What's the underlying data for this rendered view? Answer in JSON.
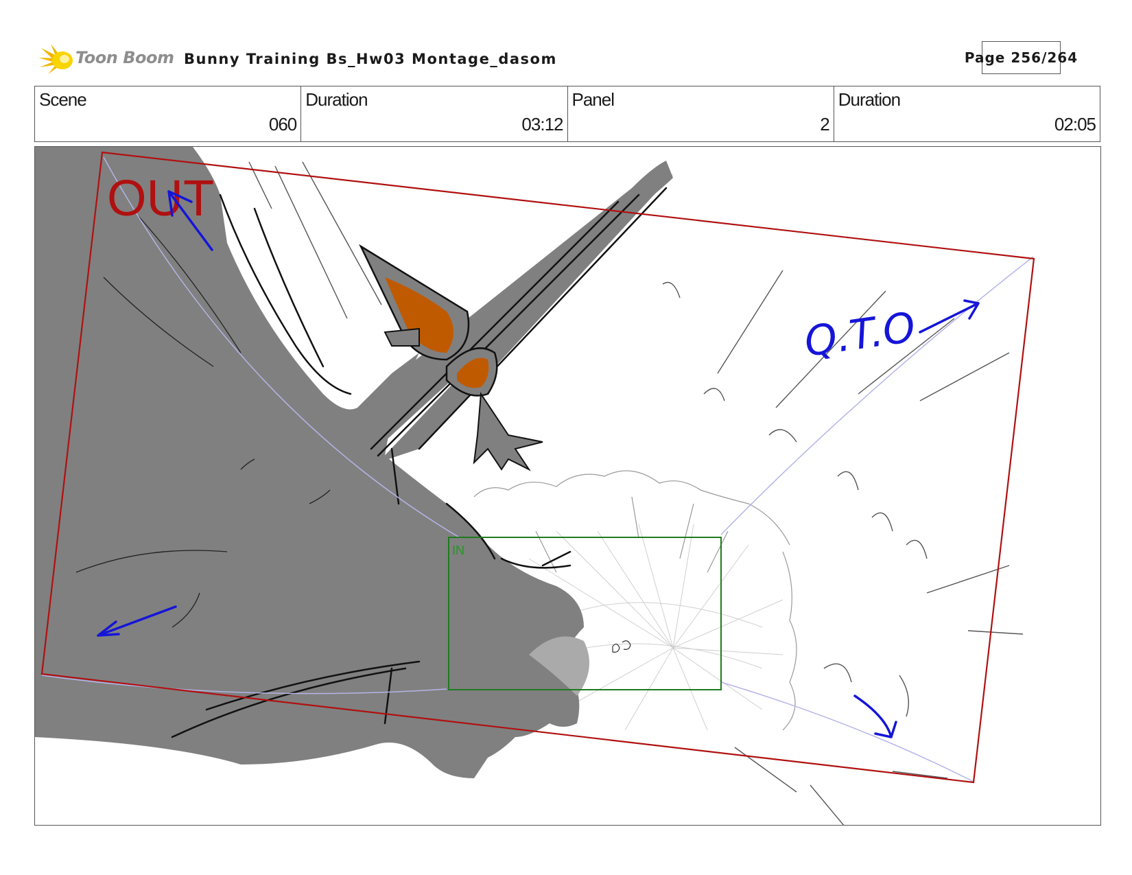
{
  "header": {
    "logo_text": "Toon Boom",
    "title": "Bunny Training  Bs_Hw03 Montage_dasom",
    "page_label": "Page 256/264"
  },
  "info": {
    "scene_label": "Scene",
    "scene_value": "060",
    "scene_duration_label": "Duration",
    "scene_duration_value": "03:12",
    "panel_label": "Panel",
    "panel_value": "2",
    "panel_duration_label": "Duration",
    "panel_duration_value": "02:05"
  },
  "drawing": {
    "out_label": "OUT",
    "in_label": "IN",
    "note_text": "Q.T.O",
    "colors": {
      "out_frame": "#b01010",
      "in_frame": "#1e7a1e",
      "annotation_blue": "#1515d8",
      "guide_lavender": "#b4b4e8",
      "tree_gray": "#808080",
      "bird_orange": "#c05a00"
    }
  }
}
